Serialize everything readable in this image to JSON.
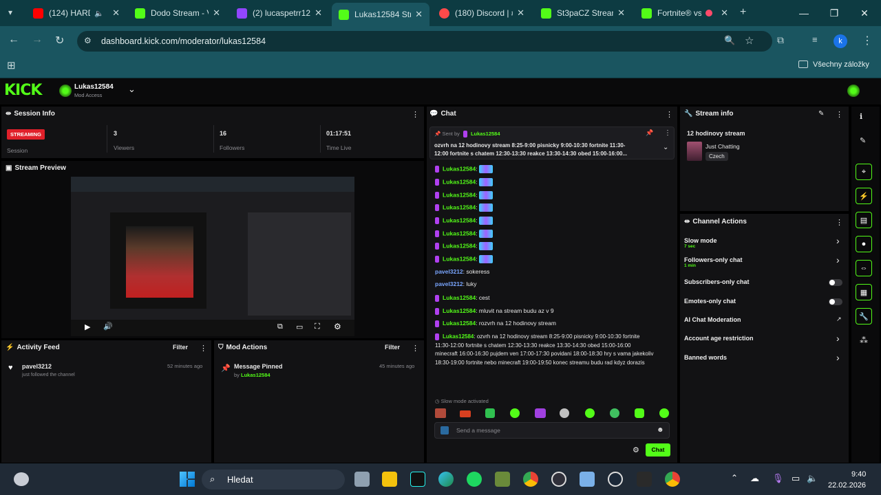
{
  "browser": {
    "tabs": [
      {
        "title": "(124) HARD",
        "color": "#ff0000"
      },
      {
        "title": "Dodo Stream - V",
        "color": "#53fc18"
      },
      {
        "title": "(2) lucaspetrr12",
        "color": "#9146ff"
      },
      {
        "title": "Lukas12584 Stre",
        "color": "#53fc18"
      },
      {
        "title": "(180) Discord | #",
        "color": "#ff4a4a"
      },
      {
        "title": "St3paCZ Stream",
        "color": "#53fc18"
      },
      {
        "title": "Fortnite® vs",
        "color": "#53fc18"
      }
    ],
    "url": "dashboard.kick.com/moderator/lukas12584",
    "bookmarks_folder": "Všechny záložky",
    "profile_initial": "k"
  },
  "kick": {
    "logo": "KICK",
    "channel_name": "Lukas12584",
    "access": "Mod Access"
  },
  "session": {
    "title": "Session Info",
    "status": "STREAMING",
    "status_label": "Session",
    "viewers": "3",
    "viewers_label": "Viewers",
    "followers": "16",
    "followers_label": "Followers",
    "time_live": "01:17:51",
    "time_live_label": "Time Live"
  },
  "preview": {
    "title": "Stream Preview"
  },
  "activity": {
    "title": "Activity Feed",
    "filter": "Filter",
    "user": "pavel3212",
    "text": "just followed the channel",
    "time": "52 minutes ago"
  },
  "mod_actions": {
    "title": "Mod Actions",
    "filter": "Filter",
    "action": "Message Pinned",
    "by_label": "by",
    "by_user": "Lukas12584",
    "time": "45 minutes ago"
  },
  "chat": {
    "title": "Chat",
    "pinned_sent_by": "Sent by",
    "pinned_user": "Lukas12584",
    "pinned_text_1": "ozvrh na 12 hodinovy stream 8:25-9:00 pisnicky 9:00-10:30 fortnite 11:30-",
    "pinned_text_2": "12:00 fortnite s chatem 12:30-13:30 reakce 13:30-14:30 obed 15:00-16:00...",
    "messages": [
      {
        "user": "Lukas12584",
        "text": ":",
        "emote": true
      },
      {
        "user": "Lukas12584",
        "text": ":",
        "emote": true
      },
      {
        "user": "Lukas12584",
        "text": ":",
        "emote": true
      },
      {
        "user": "Lukas12584",
        "text": ":",
        "emote": true
      },
      {
        "user": "Lukas12584",
        "text": ":",
        "emote": true
      },
      {
        "user": "Lukas12584",
        "text": ":",
        "emote": true
      },
      {
        "user": "Lukas12584",
        "text": ":",
        "emote": true
      },
      {
        "user": "Lukas12584",
        "text": ":",
        "emote": true
      },
      {
        "user": "pavel3212",
        "text": ": sokeress",
        "emote": false
      },
      {
        "user": "pavel3212",
        "text": ": luky",
        "emote": false
      },
      {
        "user": "Lukas12584",
        "text": ": cest",
        "emote": false
      },
      {
        "user": "Lukas12584",
        "text": ": mluvit na stream budu az v 9",
        "emote": false
      },
      {
        "user": "Lukas12584",
        "text": ": rozvrh na 12 hodinovy stream",
        "emote": false
      }
    ],
    "long_msg_user": "Lukas12584",
    "long_msg_1": ": ozvrh na 12 hodinovy stream 8:25-9:00 pisnicky 9:00-10:30 fortnite",
    "long_msg_2": "11:30-12:00 fortnite s chatem 12:30-13:30 reakce 13:30-14:30 obed 15:00-16:00",
    "long_msg_3": "minecraft 16:00-16:30 pujdem ven 17:00-17:30 povidani 18:00-18:30 hry s vama jakekoliv",
    "long_msg_4": "18:30-19:00 fortnite nebo minecraft 19:00-19:50 konec streamu budu rad kdyz dorazis",
    "slow_mode_notice": "Slow mode activated",
    "placeholder": "Send a message",
    "send": "Chat"
  },
  "stream_info": {
    "title": "Stream info",
    "stream_title": "12 hodinovy stream",
    "category": "Just Chatting",
    "language": "Czech"
  },
  "channel_actions": {
    "title": "Channel Actions",
    "items": [
      {
        "label": "Slow mode",
        "sub": "7 sec",
        "kind": "chevron"
      },
      {
        "label": "Followers-only chat",
        "sub": "1 min",
        "kind": "chevron"
      },
      {
        "label": "Subscribers-only chat",
        "sub": "",
        "kind": "toggle"
      },
      {
        "label": "Emotes-only chat",
        "sub": "",
        "kind": "toggle"
      },
      {
        "label": "AI Chat Moderation",
        "sub": "",
        "kind": "external"
      },
      {
        "label": "Account age restriction",
        "sub": "",
        "kind": "chevron"
      },
      {
        "label": "Banned words",
        "sub": "",
        "kind": "chevron"
      }
    ]
  },
  "taskbar": {
    "search": "Hledat",
    "time": "9:40",
    "date": "22.02.2026"
  },
  "colors": {
    "kick_green": "#53fc18",
    "streaming_red": "#e0202a",
    "panel": "#121214"
  }
}
